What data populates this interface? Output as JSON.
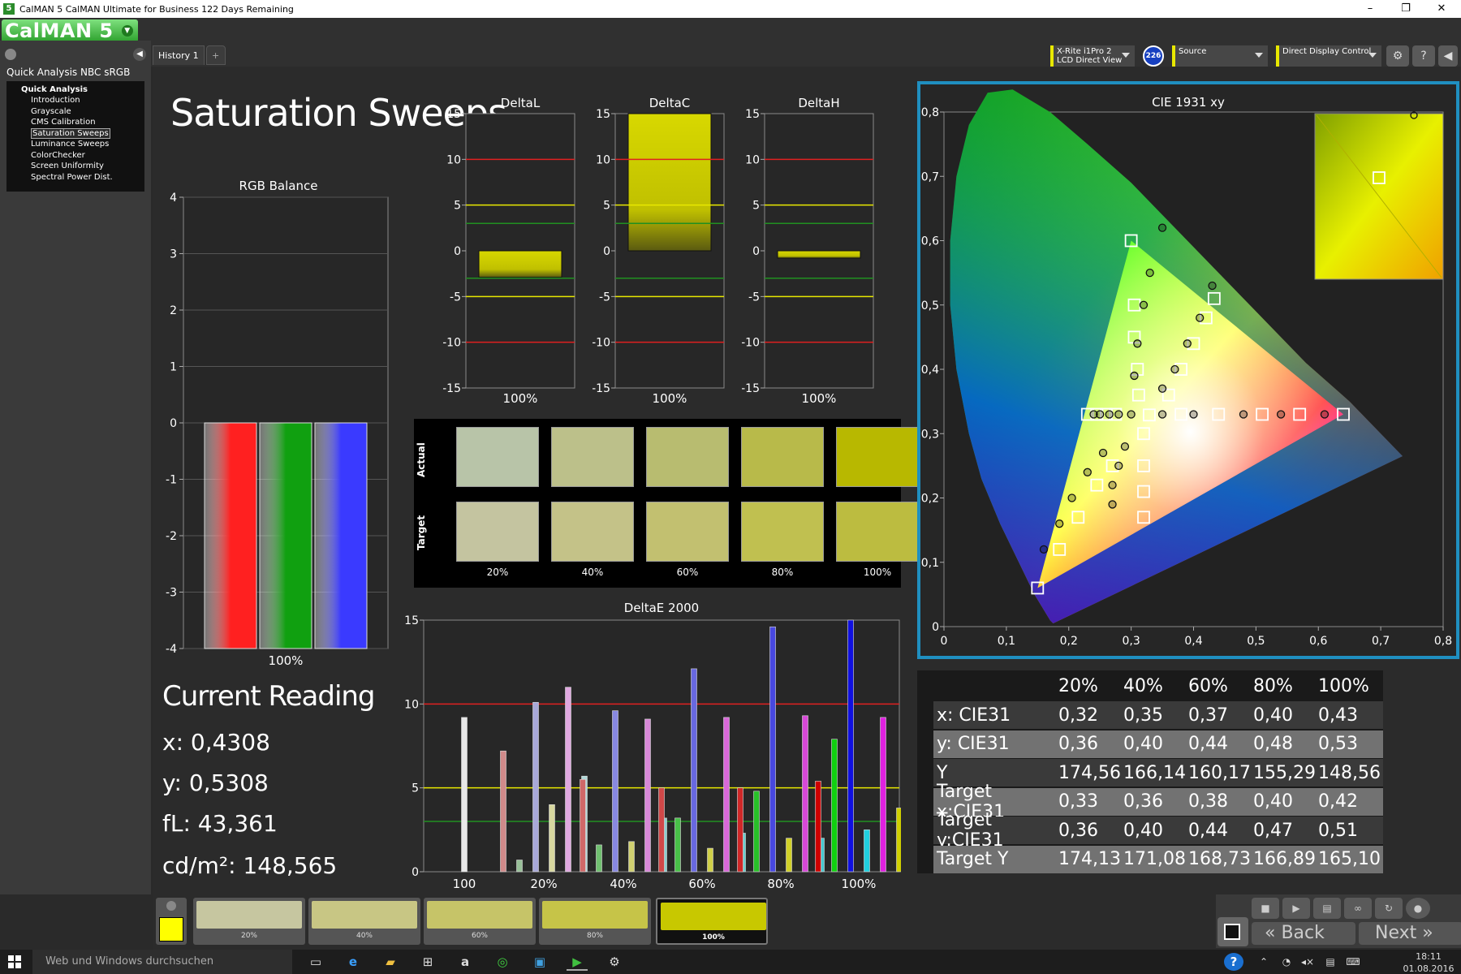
{
  "window": {
    "title": "CalMAN 5 CalMAN Ultimate for Business 122 Days Remaining",
    "app_icon": "5",
    "logo": "CalMAN 5",
    "min": "–",
    "max": "❐",
    "close": "✕"
  },
  "workflow": {
    "title": "Quick Analysis NBC sRGB",
    "root": "Quick Analysis",
    "items": [
      "Introduction",
      "Grayscale",
      "CMS Calibration",
      "Saturation Sweeps",
      "Luminance Sweeps",
      "ColorChecker",
      "Screen Uniformity",
      "Spectral Power Dist."
    ],
    "selected_index": 3
  },
  "tabs": [
    {
      "label": "History 1"
    }
  ],
  "tab_add": "+",
  "devices": {
    "meter_line1": "X-Rite i1Pro 2",
    "meter_line2": "LCD Direct View",
    "meter_badge": "226",
    "source": "Source",
    "display": "Direct Display Control"
  },
  "page": {
    "title": "Saturation Sweeps",
    "current_reading_title": "Current Reading",
    "reading_x": "x: 0,4308",
    "reading_y": "y: 0,5308",
    "reading_fl": "fL: 43,361",
    "reading_cd": "cd/m²: 148,565"
  },
  "chart_data": [
    {
      "type": "bar",
      "title": "RGB Balance",
      "categories": [
        "100%"
      ],
      "series": [
        {
          "values": [
            -4
          ]
        },
        {
          "values": [
            -4
          ]
        },
        {
          "values": [
            -4
          ]
        }
      ],
      "colors": [
        "#ff2020",
        "#10a010",
        "#3a3aff"
      ],
      "yticks": [
        "4",
        "3",
        "2",
        "1",
        "0",
        "-1",
        "-2",
        "-3",
        "-4"
      ],
      "ylim": [
        -4,
        4
      ]
    },
    {
      "type": "bar",
      "title": "DeltaL",
      "categories": [
        "100%"
      ],
      "values": [
        -2.9
      ],
      "yticks": [
        "15",
        "10",
        "5",
        "0",
        "-5",
        "-10",
        "-15"
      ],
      "ylim": [
        -15,
        15
      ]
    },
    {
      "type": "bar",
      "title": "DeltaC",
      "categories": [
        "100%"
      ],
      "values": [
        15
      ],
      "yticks": [
        "15",
        "10",
        "5",
        "0",
        "-5",
        "-10",
        "-15"
      ],
      "ylim": [
        -15,
        15
      ]
    },
    {
      "type": "bar",
      "title": "DeltaH",
      "categories": [
        "100%"
      ],
      "values": [
        -0.8
      ],
      "yticks": [
        "15",
        "10",
        "5",
        "0",
        "-5",
        "-10",
        "-15"
      ],
      "ylim": [
        -15,
        15
      ]
    },
    {
      "type": "bar",
      "title": "DeltaE 2000",
      "categories": [
        "100",
        "20%",
        "40%",
        "60%",
        "80%",
        "100%"
      ],
      "yticks": [
        "15",
        "10",
        "5",
        "0"
      ],
      "ylim": [
        0,
        15
      ],
      "groups": [
        {
          "values": [
            9.2
          ],
          "colors": [
            "#e8e8e8"
          ]
        },
        {
          "values": [
            7.2,
            0.7,
            10.1,
            4.0,
            11.0,
            5.7
          ],
          "colors": [
            "#d08a8a",
            "#98c098",
            "#a8a8d8",
            "#d8d8a0",
            "#e0a8e0",
            "#b0d8d8"
          ]
        },
        {
          "values": [
            5.5,
            1.6,
            9.6,
            1.8,
            9.1,
            3.2
          ],
          "colors": [
            "#d06868",
            "#70c070",
            "#8888e0",
            "#d0d070",
            "#d888d8",
            "#88d0d0"
          ]
        },
        {
          "values": [
            5.0,
            3.2,
            12.1,
            1.4,
            9.2,
            2.3
          ],
          "colors": [
            "#d04848",
            "#48c048",
            "#6868e0",
            "#d0d048",
            "#d868d8",
            "#68d0d0"
          ]
        },
        {
          "values": [
            5.0,
            4.8,
            14.6,
            2.0,
            9.3,
            2.0
          ],
          "colors": [
            "#d02828",
            "#28c028",
            "#4848e0",
            "#d0d028",
            "#d848d8",
            "#48c8d0"
          ]
        },
        {
          "values": [
            5.4,
            7.9,
            15.0,
            2.5,
            9.2,
            3.8
          ],
          "colors": [
            "#d00000",
            "#10d010",
            "#1010e0",
            "#20d0e0",
            "#e020e0",
            "#d0d000"
          ]
        }
      ]
    },
    {
      "type": "scatter",
      "title": "CIE 1931 xy",
      "xticks": [
        "0",
        "0,1",
        "0,2",
        "0,3",
        "0,4",
        "0,5",
        "0,6",
        "0,7",
        "0,8"
      ],
      "yticks": [
        "0",
        "0,1",
        "0,2",
        "0,3",
        "0,4",
        "0,5",
        "0,6",
        "0,7",
        "0,8"
      ],
      "xlim": [
        0,
        0.8
      ],
      "ylim": [
        0,
        0.8
      ],
      "gamut": [
        [
          0.64,
          0.33
        ],
        [
          0.3,
          0.6
        ],
        [
          0.15,
          0.06
        ]
      ],
      "targets": [
        [
          0.3,
          0.6
        ],
        [
          0.305,
          0.5
        ],
        [
          0.305,
          0.45
        ],
        [
          0.31,
          0.4
        ],
        [
          0.312,
          0.36
        ],
        [
          0.329,
          0.329
        ],
        [
          0.38,
          0.33
        ],
        [
          0.44,
          0.33
        ],
        [
          0.51,
          0.33
        ],
        [
          0.57,
          0.33
        ],
        [
          0.64,
          0.33
        ],
        [
          0.32,
          0.3
        ],
        [
          0.32,
          0.25
        ],
        [
          0.32,
          0.21
        ],
        [
          0.32,
          0.17
        ],
        [
          0.15,
          0.06
        ],
        [
          0.185,
          0.12
        ],
        [
          0.215,
          0.17
        ],
        [
          0.245,
          0.22
        ],
        [
          0.27,
          0.25
        ],
        [
          0.433,
          0.51
        ],
        [
          0.42,
          0.48
        ],
        [
          0.4,
          0.44
        ],
        [
          0.38,
          0.4
        ],
        [
          0.36,
          0.36
        ],
        [
          0.275,
          0.33
        ],
        [
          0.26,
          0.33
        ],
        [
          0.245,
          0.33
        ],
        [
          0.23,
          0.33
        ]
      ],
      "measured": [
        [
          0.35,
          0.62
        ],
        [
          0.33,
          0.55
        ],
        [
          0.32,
          0.5
        ],
        [
          0.31,
          0.44
        ],
        [
          0.305,
          0.39
        ],
        [
          0.3,
          0.33
        ],
        [
          0.35,
          0.33
        ],
        [
          0.4,
          0.33
        ],
        [
          0.48,
          0.33
        ],
        [
          0.54,
          0.33
        ],
        [
          0.61,
          0.33
        ],
        [
          0.29,
          0.28
        ],
        [
          0.28,
          0.25
        ],
        [
          0.27,
          0.22
        ],
        [
          0.27,
          0.19
        ],
        [
          0.16,
          0.12
        ],
        [
          0.185,
          0.16
        ],
        [
          0.205,
          0.2
        ],
        [
          0.23,
          0.24
        ],
        [
          0.255,
          0.27
        ],
        [
          0.43,
          0.53
        ],
        [
          0.41,
          0.48
        ],
        [
          0.39,
          0.44
        ],
        [
          0.37,
          0.4
        ],
        [
          0.35,
          0.37
        ],
        [
          0.28,
          0.33
        ],
        [
          0.265,
          0.33
        ],
        [
          0.25,
          0.33
        ],
        [
          0.24,
          0.33
        ]
      ]
    }
  ],
  "patches": {
    "actual_label": "Actual",
    "target_label": "Target",
    "labels": [
      "20%",
      "40%",
      "60%",
      "80%",
      "100%"
    ],
    "actual": [
      "#b8c4a8",
      "#bcc08a",
      "#b8bc70",
      "#b8ba4a",
      "#b8b800"
    ],
    "target": [
      "#c4c4a0",
      "#c4c288",
      "#c2c070",
      "#c0c050",
      "#bcbc40"
    ]
  },
  "table": {
    "header": [
      "",
      "20%",
      "40%",
      "60%",
      "80%",
      "100%"
    ],
    "rows": [
      {
        "label": "x: CIE31",
        "values": [
          "0,32",
          "0,35",
          "0,37",
          "0,40",
          "0,43"
        ]
      },
      {
        "label": "y: CIE31",
        "values": [
          "0,36",
          "0,40",
          "0,44",
          "0,48",
          "0,53"
        ]
      },
      {
        "label": "Y",
        "values": [
          "174,56",
          "166,14",
          "160,17",
          "155,29",
          "148,56"
        ]
      },
      {
        "label": "Target x:CIE31",
        "values": [
          "0,33",
          "0,36",
          "0,38",
          "0,40",
          "0,42"
        ]
      },
      {
        "label": "Target y:CIE31",
        "values": [
          "0,36",
          "0,40",
          "0,44",
          "0,47",
          "0,51"
        ]
      },
      {
        "label": "Target Y",
        "values": [
          "174,13",
          "171,08",
          "168,73",
          "166,89",
          "165,10"
        ]
      }
    ]
  },
  "swatches": [
    {
      "label": "20%",
      "color": "#c6c6a0"
    },
    {
      "label": "40%",
      "color": "#c8c684"
    },
    {
      "label": "60%",
      "color": "#c6c468"
    },
    {
      "label": "80%",
      "color": "#c6c448"
    },
    {
      "label": "100%",
      "color": "#c8c800"
    }
  ],
  "nav": {
    "back": "Back",
    "next": "Next"
  },
  "taskbar": {
    "search_placeholder": "Web und Windows durchsuchen",
    "time": "18:11",
    "date": "01.08.2016"
  }
}
